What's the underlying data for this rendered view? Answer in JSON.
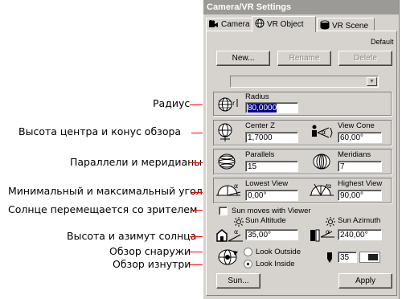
{
  "annotations": [
    "Радиус",
    "Высота центра и конус обзора",
    "Параллели и меридианы",
    "Минимальный и максимальный угол",
    "Солнце перемещается со зрителем",
    "Высота и азимут солнца",
    "Обзор снаружи",
    "Обзор изнутри"
  ],
  "window": {
    "title": "Camera/VR Settings"
  },
  "tabs": [
    "Camera",
    "VR Object",
    "VR Scene"
  ],
  "panel": {
    "default_label": "Default",
    "new_btn": "New...",
    "rename_btn": "Rename",
    "delete_btn": "Delete",
    "radius_label": "Radius",
    "radius_value": "80,0000",
    "center_z_label": "Center Z",
    "center_z_value": "1,7000",
    "view_cone_label": "View Cone",
    "view_cone_value": "60,00°",
    "parallels_label": "Parallels",
    "parallels_value": "15",
    "meridians_label": "Meridians",
    "meridians_value": "7",
    "lowest_label": "Lowest View",
    "lowest_value": "0,00°",
    "highest_label": "Highest View",
    "highest_value": "90,00°",
    "sun_moves_label": "Sun moves with Viewer",
    "sun_altitude_label": "Sun Altitude",
    "sun_altitude_value": "35,00°",
    "sun_azimuth_label": "Sun Azimuth",
    "sun_azimuth_value": "240,00°",
    "look_outside_label": "Look Outside",
    "look_inside_label": "Look Inside",
    "pen_value": "35",
    "sun_btn": "Sun...",
    "apply_btn": "Apply"
  }
}
